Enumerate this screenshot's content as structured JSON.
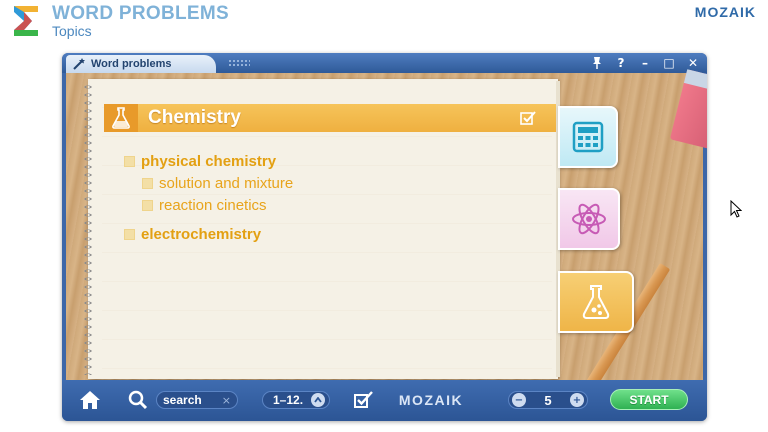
{
  "header": {
    "title": "WORD PROBLEMS",
    "subtitle": "Topics",
    "brand": "MOZAIK"
  },
  "window": {
    "tab_label": "Word problems",
    "controls": [
      "pin-icon",
      "help-icon",
      "minimize-icon",
      "maximize-icon",
      "close-icon"
    ],
    "control_glyphs": {
      "help": "?",
      "minimize": "–",
      "maximize": "□",
      "close": "✕"
    }
  },
  "notebook": {
    "topic_title": "Chemistry",
    "items": [
      {
        "label": "physical chemistry",
        "level": 1
      },
      {
        "label": "solution and mixture",
        "level": 2
      },
      {
        "label": "reaction cinetics",
        "level": 2
      },
      {
        "label": "electrochemistry",
        "level": 1
      }
    ]
  },
  "side_tabs": [
    {
      "name": "mathematics",
      "icon": "calculator-icon"
    },
    {
      "name": "physics",
      "icon": "atom-icon"
    },
    {
      "name": "chemistry",
      "icon": "flask-icon",
      "active": true
    }
  ],
  "toolbar": {
    "search_label": "search",
    "search_clear": "×",
    "range_label": "1–12.",
    "brand": "MOZAIK",
    "count_value": "5",
    "count_minus": "−",
    "count_plus": "+",
    "start_label": "START"
  },
  "colors": {
    "accent_orange": "#efb040",
    "window_blue": "#3d67a8",
    "header_blue": "#7fb2d8",
    "start_green": "#2fb152"
  }
}
